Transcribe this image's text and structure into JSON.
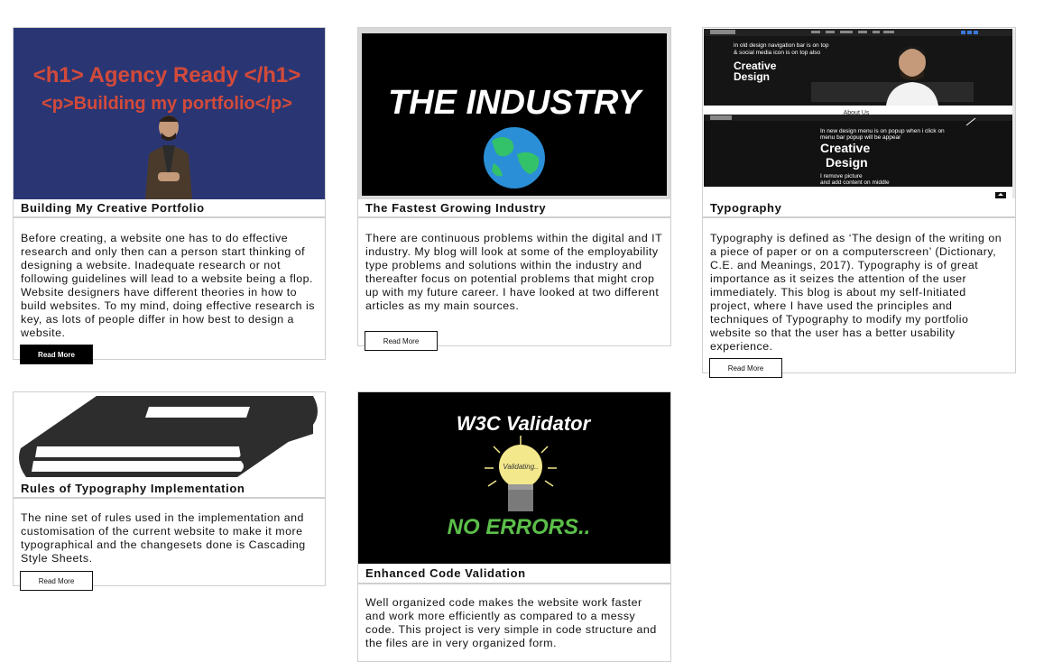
{
  "posts": [
    {
      "title": "Building My Creative Portfolio",
      "image_text": [
        "<h1> Agency Ready </h1>",
        "<p>Building my portfolio</p>"
      ],
      "excerpt": "Before creating, a website one has to do effective research and only then can a person start thinking of designing a website. Inadequate research or not following guidelines will lead to a website being a flop. Website designers have different theories in how to build websites. To my mind, doing effective research is key, as lots of people differ in how best to design a website.",
      "read_more": "Read More"
    },
    {
      "title": "The Fastest Growing Industry",
      "image_text": [
        "THE INDUSTRY"
      ],
      "excerpt": "There are continuous problems within the digital and IT industry. My blog will look at some of the employability type problems and solutions within the industry and thereafter focus on potential problems that might crop up with my future career. I have looked at two different articles as my main sources.",
      "read_more": "Read More"
    },
    {
      "title": "Typography",
      "image_text": [
        "Creative",
        "Design",
        "in old design navigation bar is on top",
        "& social media icon is on top also",
        "Creative",
        "Design",
        "In new design menu is on popup when i click on",
        "menu bar popup will be appear",
        "I remove picture",
        "and add content on middle",
        "About Us"
      ],
      "excerpt": "Typography is defined as ‘The design of the writing on a piece of paper or on a computerscreen’ (Dictionary, C.E. and Meanings, 2017). Typography is of great importance as it seizes the attention of the user immediately. This blog is about my self-Initiated project, where I have used the principles and techniques of Typography to modify my portfolio website so that the user has a better usability experience.",
      "read_more": "Read More"
    },
    {
      "title": "Rules of Typography Implementation",
      "excerpt": "The nine set of rules used in the implementation and customisation of the current website to make it more typographical and the changesets done is Cascading Style Sheets.",
      "read_more": "Read More"
    },
    {
      "title": "Enhanced Code Validation",
      "image_text": [
        "W3C Validator",
        "Validating..",
        "NO ERRORS.."
      ],
      "excerpt": "Well organized code makes the website work faster and work more efficiently as compared to a messy code. This project is very simple in code structure and the files are in very organized form."
    }
  ],
  "colors": {
    "card_border": "#cfcfcf",
    "agency_bg": "#2a3674",
    "agency_text": "#d24a3a",
    "dark_bg": "#000000",
    "validator_green": "#5cbf4a",
    "bulb_yellow": "#f3e88c"
  }
}
